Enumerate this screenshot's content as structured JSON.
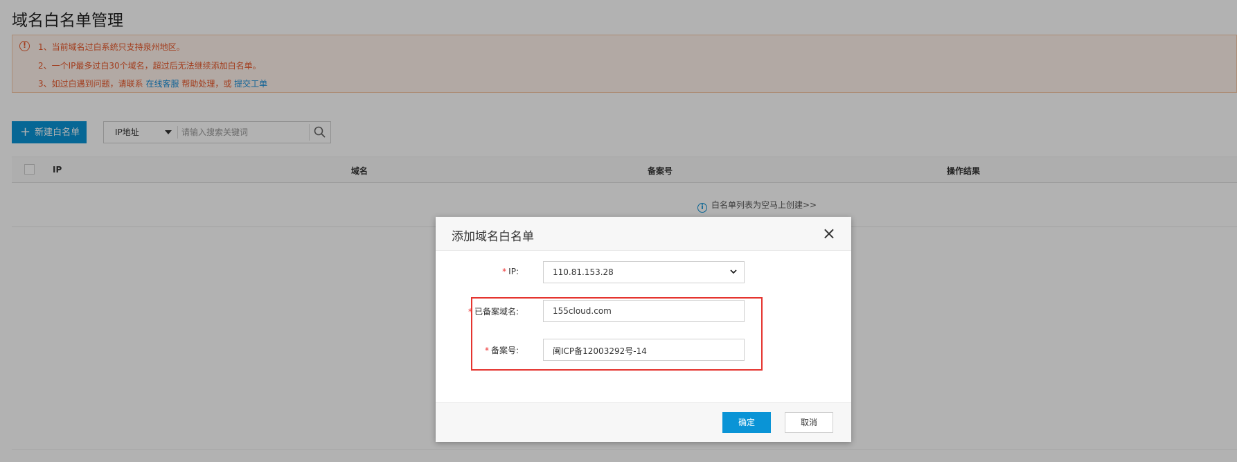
{
  "page": {
    "title": "域名白名单管理"
  },
  "notice": {
    "line1": "1、当前域名过白系统只支持泉州地区。",
    "line2": "2、一个IP最多过白30个域名，超过后无法继续添加白名单。",
    "line3_prefix": "3、如过白遇到问题，请联系",
    "line3_link1": "在线客服",
    "line3_middle": "帮助处理，或",
    "line3_link2": "提交工单",
    "icon": "warning-circle-icon"
  },
  "toolbar": {
    "new_button_icon": "+",
    "new_button_label": "新建白名单",
    "search_type": "IP地址",
    "search_placeholder": "请输入搜索关键词"
  },
  "table": {
    "columns": [
      "IP",
      "域名",
      "备案号",
      "操作结果"
    ],
    "empty_message": "白名单列表为空马上创建>>"
  },
  "modal": {
    "title": "添加域名白名单",
    "close_icon": "×",
    "fields": {
      "ip_label": "IP:",
      "ip_value": "110.81.153.28",
      "domain_label": "已备案域名:",
      "domain_value": "155cloud.com",
      "record_label": "备案号:",
      "record_value": "闽ICP备12003292号-14"
    },
    "required_mark": "*",
    "ok_label": "确定",
    "cancel_label": "取消"
  },
  "colors": {
    "primary": "#0a94d6",
    "warning": "#e8582b",
    "highlight": "#e5342f"
  }
}
